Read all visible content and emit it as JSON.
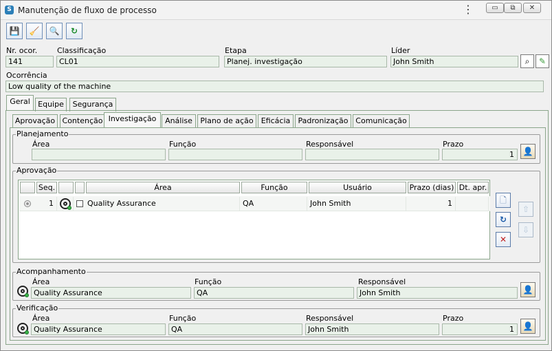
{
  "window": {
    "title": "Manutenção de fluxo de processo",
    "menu_glyph": "⋮",
    "min_glyph": "▭",
    "max_glyph": "⧉",
    "close_glyph": "✕"
  },
  "toolbar": {
    "save_glyph": "💾",
    "clear_glyph": "🧹",
    "search_glyph": "🔍",
    "refresh_glyph": "↻"
  },
  "header": {
    "nr_label": "Nr. ocor.",
    "nr_value": "141",
    "classificacao_label": "Classificação",
    "classificacao_value": "CL01",
    "etapa_label": "Etapa",
    "etapa_value": "Planej. investigação",
    "lider_label": "Líder",
    "lider_value": "John Smith",
    "ocorrencia_label": "Ocorrência",
    "ocorrencia_value": "Low quality of the machine"
  },
  "tabs": [
    {
      "label": "Geral"
    },
    {
      "label": "Equipe"
    },
    {
      "label": "Segurança"
    }
  ],
  "subtabs": [
    {
      "label": "Aprovação"
    },
    {
      "label": "Contenção"
    },
    {
      "label": "Investigação"
    },
    {
      "label": "Análise"
    },
    {
      "label": "Plano de ação"
    },
    {
      "label": "Eficácia"
    },
    {
      "label": "Padronização"
    },
    {
      "label": "Comunicação"
    }
  ],
  "planejamento": {
    "title": "Planejamento",
    "area_label": "Área",
    "area_value": "",
    "funcao_label": "Função",
    "funcao_value": "",
    "responsavel_label": "Responsável",
    "responsavel_value": "",
    "prazo_label": "Prazo",
    "prazo_value": "1"
  },
  "aprovacao": {
    "title": "Aprovação",
    "columns": [
      "",
      "Seq.",
      "",
      "",
      "Área",
      "Função",
      "Usuário",
      "Prazo (dias)",
      "Dt. apr."
    ],
    "rows": [
      {
        "seq": "1",
        "area": "Quality Assurance",
        "funcao": "QA",
        "usuario": "John Smith",
        "prazo": "1",
        "dt_apr": ""
      }
    ]
  },
  "acompanhamento": {
    "title": "Acompanhamento",
    "area_label": "Área",
    "area_value": "Quality Assurance",
    "funcao_label": "Função",
    "funcao_value": "QA",
    "responsavel_label": "Responsável",
    "responsavel_value": "John Smith"
  },
  "verificacao": {
    "title": "Verificação",
    "area_label": "Área",
    "area_value": "Quality Assurance",
    "funcao_label": "Função",
    "funcao_value": "QA",
    "responsavel_label": "Responsável",
    "responsavel_value": "John Smith",
    "prazo_label": "Prazo",
    "prazo_value": "1"
  }
}
